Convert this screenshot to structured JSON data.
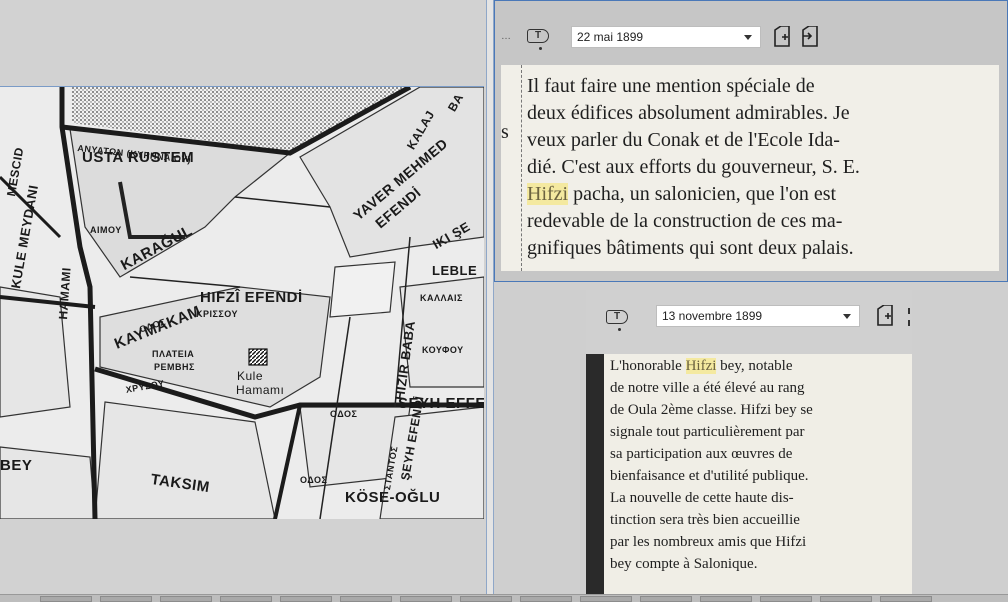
{
  "map": {
    "labels": {
      "usta_rustem": "USTA RUSTEM",
      "karagul": "KARAĞUL",
      "kaymakam": "KAYMAKAM",
      "hifzi_efendi": "HIFZÎ EFENDİ",
      "kule_hamami_name": "Kule",
      "kule_hamami_name2": "Hamamı",
      "yaver_mehmed": "YAVER MEHMED",
      "efendi": "EFENDİ",
      "hizir_baba": "HIZIR BABA",
      "seyh_efendi": "ŞEYH EFENDİ",
      "seyh_eff": "SEYH EFFE",
      "taksim": "TAKSIM",
      "kose_oglu": "KÖSE-OĞLU",
      "bey": "BEY",
      "lekle": "LEBLE",
      "iki_se": "IKI ŞE",
      "kule_meydani": "KULE MEYDANI",
      "hamami": "HAMAMI",
      "mescid": "MESCID",
      "kalaj": "KALAJ",
      "ba": "BA"
    },
    "greek_labels": {
      "anygaton": "ΑΝΥΑΤΩΝ (ΚΥΡΗΝΑΙΟΥ)",
      "krissou": "ΚΡΙΣΣΟΥ",
      "plateia1": "ΠΛΑΤΕΙΑ",
      "plateia2": "ΡΕΜΒΗΣ",
      "odos1": "ΟΔΟΣ",
      "odos2": "ΟΔΟΣ",
      "odos3": "ΟΔΟΣ",
      "xrysou": "ΧΡΥΣΟΥ",
      "aimoy": "ΑΙΜΟΥ",
      "kallais": "ΚΑΛΛΑΙΣ",
      "koyfoy": "ΚΟΥΦΟΥ",
      "ntaiotoy": "ΣΤΑΝΤΟΣ"
    }
  },
  "viewer_top": {
    "tag_label": "T",
    "date": "22 mai 1899",
    "clip_lines": [
      {
        "pre": "Il faut faire une mention spéciale de",
        "hl": "",
        "post": ""
      },
      {
        "pre": "deux édifices absolument admirables. Je",
        "hl": "",
        "post": ""
      },
      {
        "pre": "veux parler du Conak et de l'Ecole Ida-",
        "hl": "",
        "post": ""
      },
      {
        "pre": "dié. C'est aux efforts du gouverneur, S. E.",
        "hl": "",
        "post": ""
      },
      {
        "pre": "",
        "hl": "Hifzi",
        "post": " pacha, un salonicien, que l'on est"
      },
      {
        "pre": "redevable de la construction de ces ma-",
        "hl": "",
        "post": ""
      },
      {
        "pre": "gnifiques bâtiments qui sont deux palais.",
        "hl": "",
        "post": ""
      }
    ],
    "margin_s": "s"
  },
  "viewer_bottom": {
    "tag_label": "T",
    "date": "13 novembre 1899",
    "clip_lines": [
      {
        "pre": "L'honorable ",
        "hl": "Hifzi",
        "post": " bey, notable"
      },
      {
        "pre": "de notre ville a été élevé au rang",
        "hl": "",
        "post": ""
      },
      {
        "pre": "de Oula 2ème classe. Hifzi bey se",
        "hl": "",
        "post": ""
      },
      {
        "pre": "signale tout particulièrement par",
        "hl": "",
        "post": ""
      },
      {
        "pre": "sa participation aux œuvres de",
        "hl": "",
        "post": ""
      },
      {
        "pre": "bienfaisance et d'utilité publique.",
        "hl": "",
        "post": ""
      },
      {
        "pre": "  La nouvelle de cette haute dis-",
        "hl": "",
        "post": ""
      },
      {
        "pre": "tinction sera très bien accueillie",
        "hl": "",
        "post": ""
      },
      {
        "pre": "par les nombreux amis que Hifzi",
        "hl": "",
        "post": ""
      },
      {
        "pre": "bey compte à Salonique.",
        "hl": "",
        "post": ""
      }
    ]
  },
  "icons": {
    "tag": "tag-icon",
    "add_doc": "add-document-icon",
    "link_doc": "link-document-icon",
    "dropdown": "chevron-down-icon"
  },
  "colors": {
    "highlight": "#f4e9a0",
    "frame_border": "#4a78b8",
    "paper": "#f1efe8"
  }
}
